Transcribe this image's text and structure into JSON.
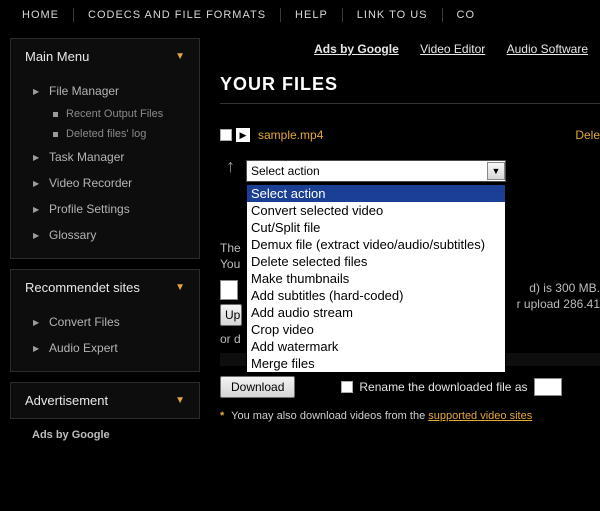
{
  "topnav": [
    "HOME",
    "CODECS AND FILE FORMATS",
    "HELP",
    "LINK TO US",
    "CO"
  ],
  "sidebar": {
    "panels": [
      {
        "title": "Main Menu",
        "items": [
          {
            "label": "File Manager",
            "sub": [
              "Recent Output Files",
              "Deleted files' log"
            ]
          },
          {
            "label": "Task Manager"
          },
          {
            "label": "Video Recorder"
          },
          {
            "label": "Profile Settings"
          },
          {
            "label": "Glossary"
          }
        ]
      },
      {
        "title": "Recommendet sites",
        "items": [
          {
            "label": "Convert Files"
          },
          {
            "label": "Audio Expert"
          }
        ]
      },
      {
        "title": "Advertisement",
        "ads_label": "Ads by Google"
      }
    ]
  },
  "ads_links": {
    "label": "Ads by Google",
    "links": [
      "Video Editor",
      "Audio Software"
    ]
  },
  "heading": "YOUR FILES",
  "file": {
    "name": "sample.mp4",
    "delete_label": "Dele"
  },
  "select": {
    "display": "Select action",
    "options": [
      "Select action",
      "Convert selected video",
      "Cut/Split file",
      "Demux file (extract video/audio/subtitles)",
      "Delete selected files",
      "Make thumbnails",
      "Add subtitles (hard-coded)",
      "Add audio stream",
      "Crop video",
      "Add watermark",
      "Merge files"
    ],
    "selected_index": 0
  },
  "limits": {
    "line1_tail": "d) is 300 MB.",
    "line2": "You",
    "line2_tail": "r upload 286.41"
  },
  "buttons": {
    "upload": "Up",
    "download": "Download",
    "or": "or"
  },
  "rename": {
    "label": "Rename the downloaded file as"
  },
  "footnote": {
    "asterisk": "*",
    "text": "You may also download videos from the ",
    "link": "supported video sites"
  }
}
